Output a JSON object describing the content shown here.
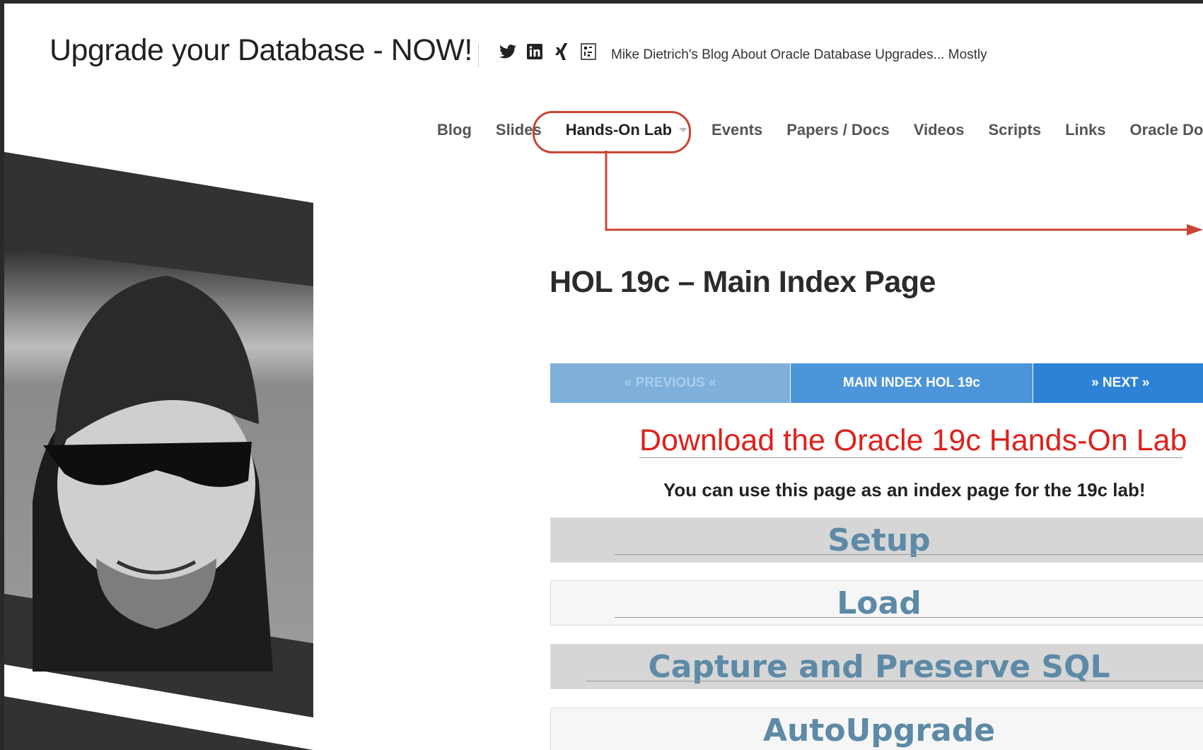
{
  "site": {
    "title": "Upgrade your Database - NOW!",
    "tagline": "Mike Dietrich's Blog About Oracle Database Upgrades... Mostly",
    "social_icons": [
      "twitter-icon",
      "linkedin-icon",
      "xing-icon",
      "qr-code-icon"
    ]
  },
  "nav": {
    "items": [
      {
        "label": "Blog"
      },
      {
        "label": "Slides"
      },
      {
        "label": "Hands-On Lab",
        "active": true,
        "has_dropdown": true
      },
      {
        "label": "Events"
      },
      {
        "label": "Papers / Docs"
      },
      {
        "label": "Videos"
      },
      {
        "label": "Scripts"
      },
      {
        "label": "Links"
      },
      {
        "label": "Oracle Docume"
      }
    ]
  },
  "annotation": {
    "color": "#c84535"
  },
  "post": {
    "title": "HOL 19c – Main Index Page",
    "pager": {
      "previous": "« PREVIOUS «",
      "main": "MAIN INDEX HOL 19c",
      "next": "» NEXT »"
    },
    "download_link": "Download the Oracle 19c Hands-On Lab",
    "intro": "You can use this page as an index page for the 19c lab!",
    "sections": [
      "Setup",
      "Load",
      "Capture and Preserve SQL",
      "AutoUpgrade"
    ]
  },
  "colors": {
    "download_red": "#e0201b",
    "section_blue": "#5d8aa6",
    "pager_blue": "#2d82d6"
  }
}
